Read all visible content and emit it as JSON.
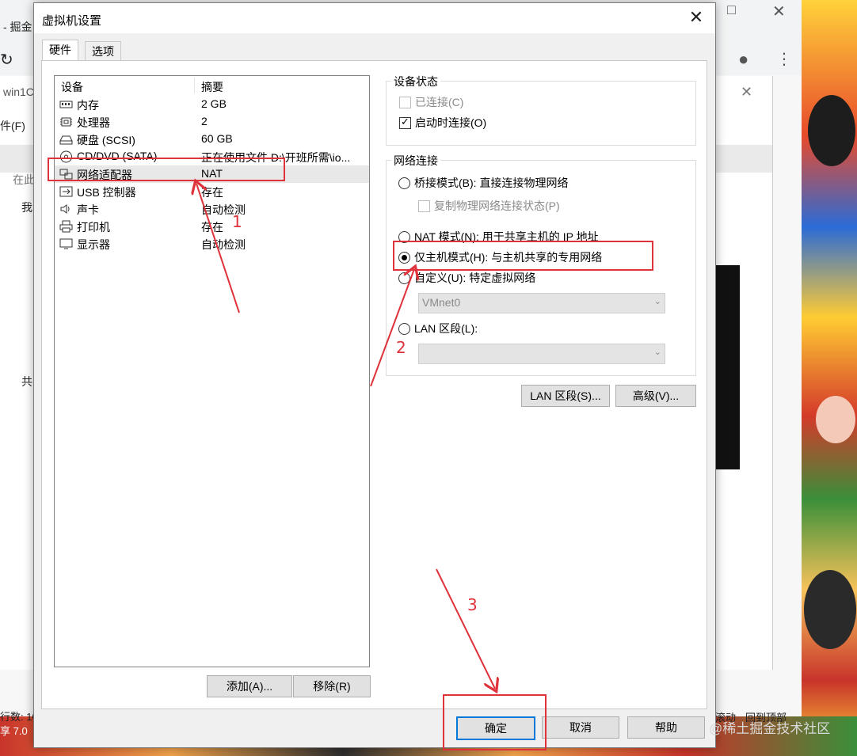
{
  "background": {
    "browser_tab_fragment": "- 掘金",
    "tab2_fragment": "win1C",
    "menu_file": "件(F)",
    "search_fragment": "在此",
    "tree_root": "我",
    "tree_shared": "共",
    "status_rows": "行数: 10",
    "status_version": "享 7.0",
    "scroll_label": "滚动",
    "back_to_top": "回到顶部",
    "watermark": "@稀土掘金技术社区"
  },
  "dialog": {
    "title": "虚拟机设置",
    "tabs": [
      "硬件",
      "选项"
    ],
    "columns": {
      "device": "设备",
      "summary": "摘要"
    },
    "devices": [
      {
        "icon": "memory-icon",
        "name": "内存",
        "summary": "2 GB"
      },
      {
        "icon": "cpu-icon",
        "name": "处理器",
        "summary": "2"
      },
      {
        "icon": "disk-icon",
        "name": "硬盘 (SCSI)",
        "summary": "60 GB"
      },
      {
        "icon": "cd-icon",
        "name": "CD/DVD (SATA)",
        "summary": "正在使用文件 D:\\开班所需\\io..."
      },
      {
        "icon": "network-icon",
        "name": "网络适配器",
        "summary": "NAT"
      },
      {
        "icon": "usb-icon",
        "name": "USB 控制器",
        "summary": "存在"
      },
      {
        "icon": "sound-icon",
        "name": "声卡",
        "summary": "自动检测"
      },
      {
        "icon": "printer-icon",
        "name": "打印机",
        "summary": "存在"
      },
      {
        "icon": "display-icon",
        "name": "显示器",
        "summary": "自动检测"
      }
    ],
    "add_button": "添加(A)...",
    "remove_button": "移除(R)",
    "device_status": {
      "title": "设备状态",
      "connected": "已连接(C)",
      "connect_on_start": "启动时连接(O)"
    },
    "network": {
      "title": "网络连接",
      "bridged": "桥接模式(B): 直接连接物理网络",
      "replicate": "复制物理网络连接状态(P)",
      "nat": "NAT 模式(N): 用于共享主机的 IP 地址",
      "host_only": "仅主机模式(H): 与主机共享的专用网络",
      "custom": "自定义(U): 特定虚拟网络",
      "custom_value": "VMnet0",
      "lan_segment": "LAN 区段(L):",
      "lan_segment_value": ""
    },
    "lan_segments_button": "LAN 区段(S)...",
    "advanced_button": "高级(V)...",
    "ok_button": "确定",
    "cancel_button": "取消",
    "help_button": "帮助"
  },
  "annotations": {
    "step1": "1",
    "step2": "2",
    "step3": "3"
  },
  "colors": {
    "annotation_red": "#e0323a",
    "focus_blue": "#0078d7"
  }
}
